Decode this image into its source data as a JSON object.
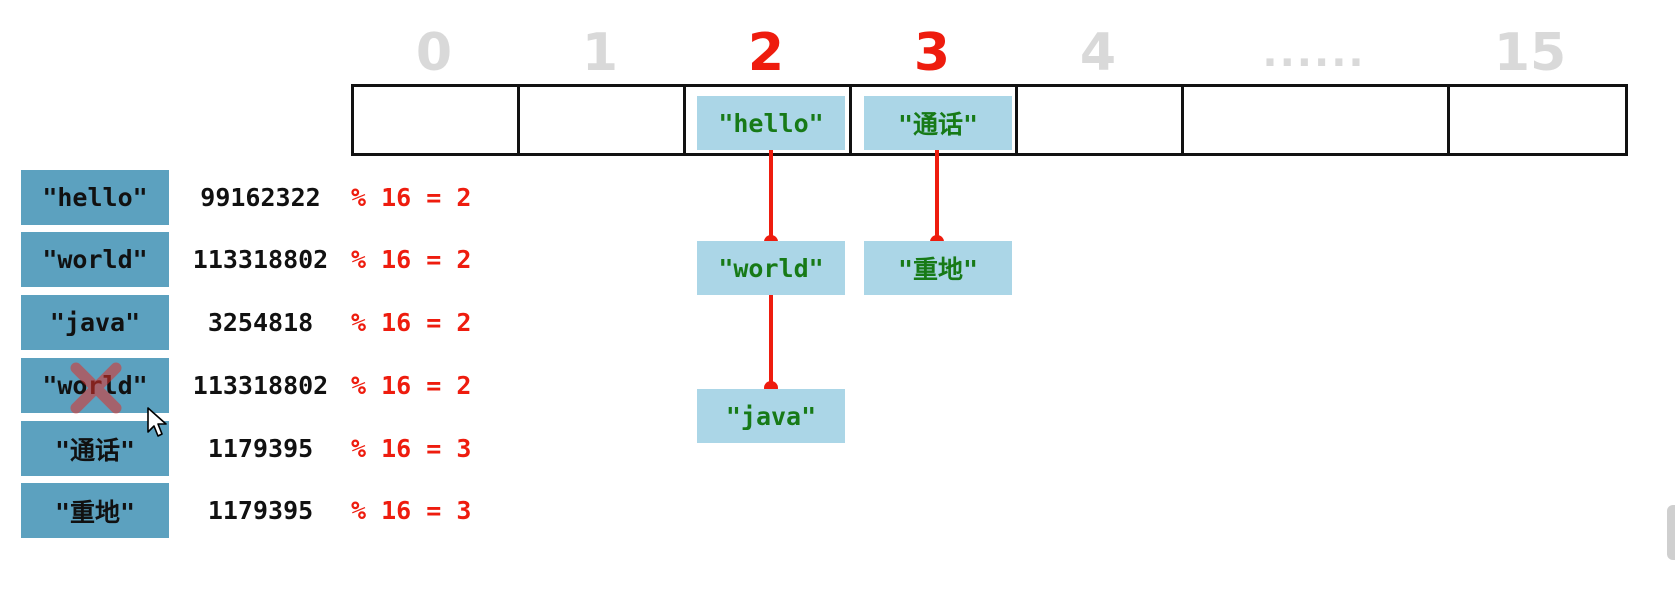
{
  "indices": [
    {
      "label": "0",
      "highlight": false
    },
    {
      "label": "1",
      "highlight": false
    },
    {
      "label": "2",
      "highlight": true
    },
    {
      "label": "3",
      "highlight": true
    },
    {
      "label": "4",
      "highlight": false
    },
    {
      "label": "......",
      "highlight": false
    },
    {
      "label": "15",
      "highlight": false
    }
  ],
  "chains": {
    "bucket2": [
      "\"hello\"",
      "\"world\"",
      "\"java\""
    ],
    "bucket3": [
      "\"通话\"",
      "\"重地\""
    ]
  },
  "keys": [
    {
      "key": "\"hello\"",
      "hash": "99162322",
      "mod": "% 16 = 2"
    },
    {
      "key": "\"world\"",
      "hash": "113318802",
      "mod": "% 16 = 2"
    },
    {
      "key": "\"java\"",
      "hash": "3254818",
      "mod": "% 16 = 2"
    },
    {
      "key": "\"world\"",
      "hash": "113318802",
      "mod": "% 16 = 2",
      "rejected": true
    },
    {
      "key": "\"通话\"",
      "hash": "1179395",
      "mod": "% 16 = 3"
    },
    {
      "key": "\"重地\"",
      "hash": "1179395",
      "mod": "% 16 = 3"
    }
  ],
  "colors": {
    "highlight": "#ee1c0e",
    "muted_index": "#d9d9d9",
    "node_bg": "#abd6e7",
    "node_text": "#177a17",
    "key_bg": "#5ca1bf"
  },
  "icons": {
    "reject": "cross-icon",
    "pointer": "cursor-icon"
  }
}
